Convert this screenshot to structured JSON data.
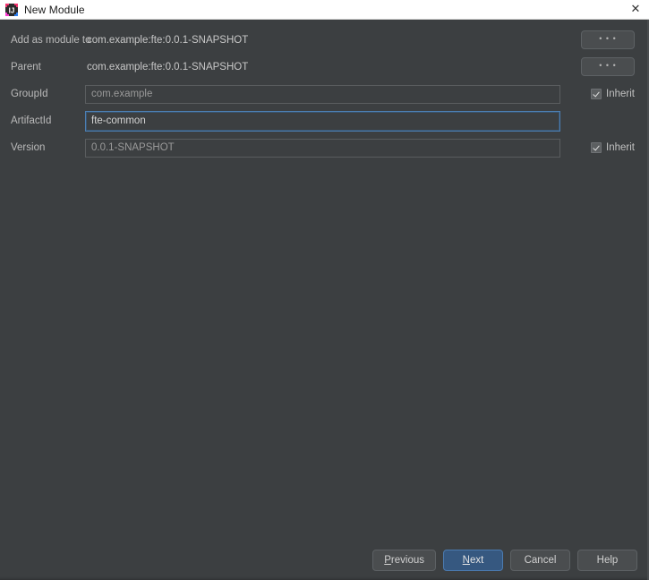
{
  "window": {
    "title": "New Module",
    "app_icon": "intellij-idea-icon",
    "close_icon": "✕"
  },
  "form": {
    "rows": [
      {
        "label": "Add as module to",
        "kind": "static",
        "value": "com.example:fte:0.0.1-SNAPSHOT",
        "browse_label": "• • •"
      },
      {
        "label": "Parent",
        "kind": "static",
        "value": "com.example:fte:0.0.1-SNAPSHOT",
        "browse_label": "• • •"
      },
      {
        "label": "GroupId",
        "kind": "field",
        "value": "com.example",
        "focused": false,
        "inherit_label": "Inherit",
        "inherit_checked": true
      },
      {
        "label": "ArtifactId",
        "kind": "field",
        "value": "fte-common",
        "focused": true,
        "inherit_label": "",
        "inherit_checked": false
      },
      {
        "label": "Version",
        "kind": "field",
        "value": "0.0.1-SNAPSHOT",
        "focused": false,
        "inherit_label": "Inherit",
        "inherit_checked": true
      }
    ]
  },
  "footer": {
    "previous": {
      "before": "",
      "mnemonic": "P",
      "after": "revious"
    },
    "next": {
      "before": "",
      "mnemonic": "N",
      "after": "ext"
    },
    "cancel": {
      "before": "Cancel",
      "mnemonic": "",
      "after": ""
    },
    "help": {
      "before": "Help",
      "mnemonic": "",
      "after": ""
    }
  },
  "colors": {
    "dialog_background": "#3c3f41",
    "titlebar_background": "#ffffff",
    "accent_default_button": "#365880",
    "focus_border": "#4c7fb3",
    "field_text_muted": "#9a9a9a",
    "label_text": "#bbbbbb"
  }
}
